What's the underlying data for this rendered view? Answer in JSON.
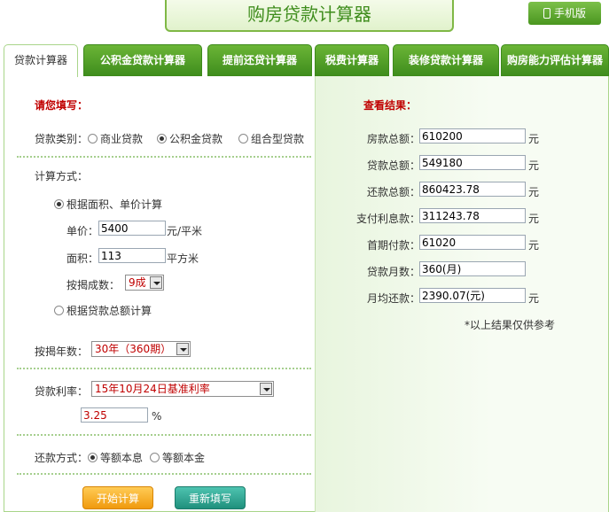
{
  "header": {
    "title": "购房贷款计算器",
    "mobile_label": "手机版"
  },
  "tabs": [
    {
      "label": "贷款计算器"
    },
    {
      "label": "公积金贷款计算器"
    },
    {
      "label": "提前还贷计算器"
    },
    {
      "label": "税费计算器"
    },
    {
      "label": "装修贷款计算器"
    },
    {
      "label": "购房能力评估计算器"
    }
  ],
  "form": {
    "title": "请您填写：",
    "loan_type_label": "贷款类别：",
    "loan_types": [
      "商业贷款",
      "公积金贷款",
      "组合型贷款"
    ],
    "calc_method_label": "计算方式：",
    "method_area_label": "根据面积、单价计算",
    "unit_price_label": "单价：",
    "unit_price_value": "5400",
    "unit_price_unit": "元/平米",
    "area_label": "面积：",
    "area_value": "113",
    "area_unit": "平方米",
    "ratio_label": "按揭成数：",
    "ratio_value": "9成",
    "method_total_label": "根据贷款总额计算",
    "years_label": "按揭年数：",
    "years_value": "30年（360期）",
    "rate_label": "贷款利率：",
    "rate_value": "15年10月24日基准利率",
    "rate_percent": "3.25",
    "percent_sign": "%",
    "repay_label": "还款方式：",
    "repay_options": [
      "等额本息",
      "等额本金"
    ],
    "start_button": "开始计算",
    "reset_button": "重新填写"
  },
  "results": {
    "title": "查看结果：",
    "rows": [
      {
        "label": "房款总额：",
        "value": "610200",
        "unit": "元"
      },
      {
        "label": "贷款总额：",
        "value": "549180",
        "unit": "元"
      },
      {
        "label": "还款总额：",
        "value": "860423.78",
        "unit": "元"
      },
      {
        "label": "支付利息款：",
        "value": "311243.78",
        "unit": "元"
      },
      {
        "label": "首期付款：",
        "value": "61020",
        "unit": "元"
      },
      {
        "label": "贷款月数：",
        "value": "360(月)",
        "unit": ""
      },
      {
        "label": "月均还款：",
        "value": "2390.07(元)",
        "unit": "元"
      }
    ],
    "note": "*以上结果仅供参考"
  }
}
